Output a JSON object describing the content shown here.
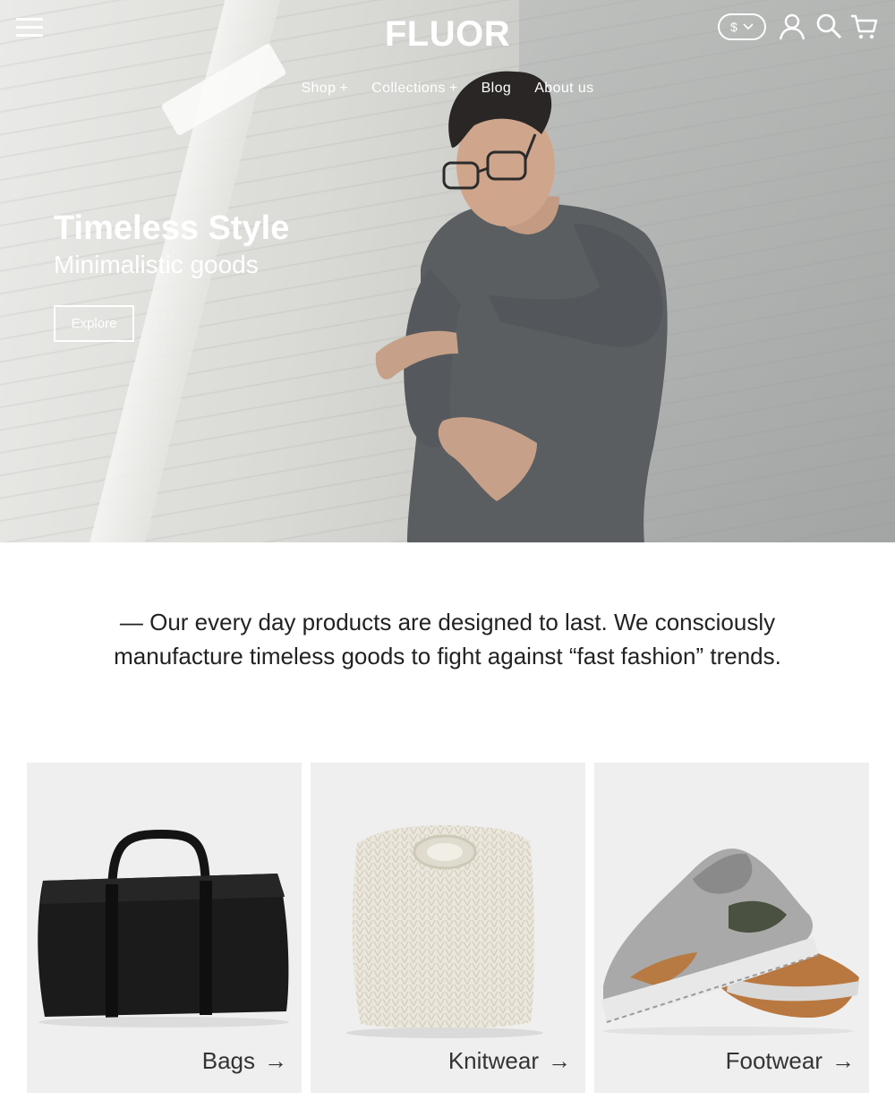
{
  "header": {
    "logo": "FLUOR",
    "currency": "$",
    "nav": [
      {
        "label": "Shop",
        "has_submenu": true
      },
      {
        "label": "Collections",
        "has_submenu": true
      },
      {
        "label": "Blog",
        "has_submenu": false
      },
      {
        "label": "About us",
        "has_submenu": false
      }
    ],
    "submenu_symbol": "+"
  },
  "hero": {
    "title": "Timeless Style",
    "subtitle": "Minimalistic goods",
    "cta_label": "Explore"
  },
  "intro": {
    "line1": "— Our every day products are designed to last. We consciously",
    "line2": "manufacture timeless goods to fight against “fast fashion” trends."
  },
  "categories": [
    {
      "label": "Bags",
      "arrow": "→"
    },
    {
      "label": "Knitwear",
      "arrow": "→"
    },
    {
      "label": "Footwear",
      "arrow": "→"
    }
  ],
  "colors": {
    "header_text": "#ffffff",
    "card_background": "#efefef",
    "body_text": "#222222"
  },
  "icons": [
    "menu-icon",
    "chevron-down-icon",
    "user-icon",
    "search-icon",
    "cart-icon",
    "arrow-right-icon"
  ]
}
